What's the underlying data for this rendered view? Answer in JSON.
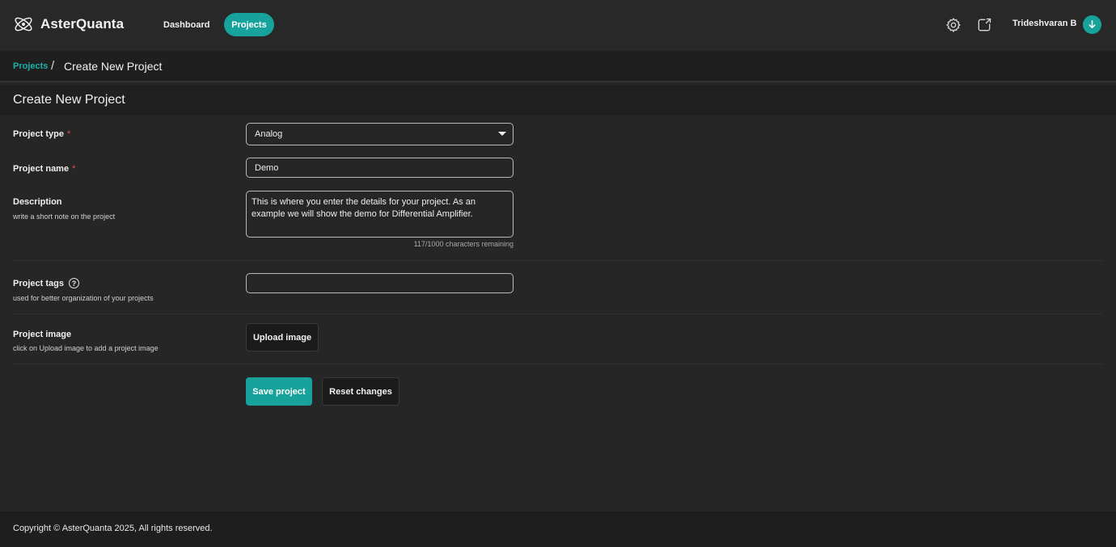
{
  "header": {
    "brand_name": "AsterQuanta",
    "nav": {
      "dashboard_label": "Dashboard",
      "projects_label": "Projects"
    },
    "icons": [
      "gear-icon",
      "share-icon",
      "download-icon"
    ],
    "user_name": "Trideshvaran B",
    "accent_color": "#17a39c"
  },
  "breadcrumb": {
    "parent": "Projects",
    "separator": "/",
    "current": "Create New Project"
  },
  "section": {
    "title": "Create New Project"
  },
  "form": {
    "project_type": {
      "label": "Project type",
      "required_mark": "*",
      "value": "Analog"
    },
    "project_name": {
      "label": "Project name",
      "required_mark": "*",
      "value": "Demo"
    },
    "description": {
      "label": "Description",
      "hint": "write a short note on the project",
      "value": "This is where you enter the details for your project. As an example we will show the demo for Differential Amplifier.",
      "char_count": "117/1000 characters remaining"
    },
    "project_tags": {
      "label": "Project tags",
      "help_glyph": "?",
      "hint": "used for better organization of your projects",
      "value": ""
    },
    "project_image": {
      "label": "Project image",
      "hint": "click on Upload image to add a project image",
      "button_label": "Upload image"
    },
    "actions": {
      "save_label": "Save project",
      "reset_label": "Reset changes"
    }
  },
  "footer": {
    "text": "Copyright © AsterQuanta 2025, All rights reserved."
  }
}
